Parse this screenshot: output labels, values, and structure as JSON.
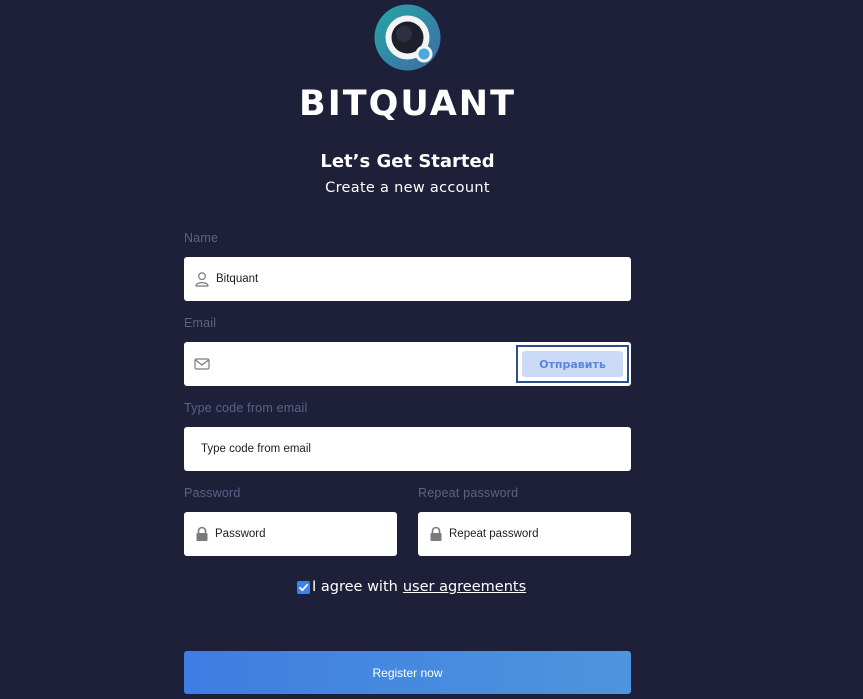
{
  "brand": {
    "name": "BITQUANT",
    "colors": {
      "ring_start": "#2ba3a3",
      "ring_end": "#3a6ea5",
      "center": "#1b1e2c"
    }
  },
  "header": {
    "title": "Let’s Get Started",
    "subtitle": "Create a new account"
  },
  "form": {
    "name": {
      "label": "Name",
      "value": "Bitquant",
      "icon": "user-icon"
    },
    "email": {
      "label": "Email",
      "value": "",
      "icon": "envelope-icon",
      "send_label": "Отправить"
    },
    "code": {
      "label": "Type code from email",
      "placeholder": "Type code from email"
    },
    "password": {
      "label": "Password",
      "placeholder": "Password",
      "icon": "lock-icon"
    },
    "repeat_password": {
      "label": "Repeat password",
      "placeholder": "Repeat password",
      "icon": "lock-icon"
    },
    "agreement": {
      "checked": true,
      "text": "I agree with",
      "link": "user agreements"
    },
    "submit_label": "Register now"
  },
  "colors": {
    "background": "#1d2038",
    "label": "#5c6288",
    "accent": "#3e7de2",
    "send_button_bg": "#cbdaf6",
    "send_button_text": "#5a86d9"
  }
}
